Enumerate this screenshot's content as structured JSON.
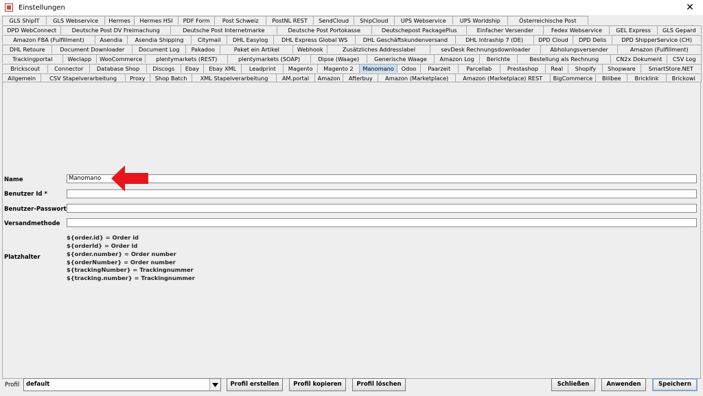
{
  "window": {
    "title": "Einstellungen",
    "icon": "app-icon",
    "close_icon": "close-icon"
  },
  "tabs": {
    "row1": [
      "GLS ShipIT",
      "GLS Webservice",
      "Hermes",
      "Hermes HSI",
      "PDF Form",
      "Post Schweiz",
      "PostNL REST",
      "SendCloud",
      "ShipCloud",
      "UPS Webservice",
      "UPS Worldship",
      "Österreichische Post"
    ],
    "row2": [
      "DPD WebConnect",
      "Deutsche Post DV Freimachung",
      "Deutsche Post Internetmarke",
      "Deutsche Post Portokasse",
      "Deutschepost PackagePlus",
      "Einfacher Versender",
      "Fedex Webservice",
      "GEL Express",
      "GLS Gepard"
    ],
    "row3": [
      "Amazon FBA (Fulfillment)",
      "Asendia",
      "Asendia Shipping",
      "Citymail",
      "DHL Easylog",
      "DHL Express Global WS",
      "DHL Geschäftskundenversand",
      "DHL Intraship 7 (DE)",
      "DPD Cloud",
      "DPD Delis",
      "DPD ShipperService (CH)"
    ],
    "row4": [
      "DHL Retoure",
      "Document Downloader",
      "Document Log",
      "Pakadoo",
      "Paket ein Artikel",
      "Webhook",
      "Zusätzliches Addresslabel",
      "sevDesk Rechnungsdownloader",
      "Abholungsversender",
      "Amazon (Fulfillment)"
    ],
    "row5": [
      "Trackingportal",
      "Weclapp",
      "WooCommerce",
      "plentymarkets (REST)",
      "plentymarkets (SOAP)",
      "Dipse (Waage)",
      "Generische Waage",
      "Amazon Log",
      "Berichte",
      "Bestellung als Rechnung",
      "CN2x Dokument",
      "CSV Log"
    ],
    "row6": [
      "Brickscout",
      "Connector",
      "Database Shop",
      "Discogs",
      "Ebay",
      "Ebay XML",
      "Leadprint",
      "Magento",
      "Magento 2",
      "Manomano",
      "Odoo",
      "Paarzeit",
      "Parcellab",
      "Prestashop",
      "Real",
      "Shopify",
      "Shopware",
      "SmartStore.NET"
    ],
    "row7": [
      "Allgemein",
      "CSV Stapelverarbeitung",
      "Proxy",
      "Shop Batch",
      "XML Stapelverarbeitung",
      "AM.portal",
      "Amazon",
      "Afterbuy",
      "Amazon (Marketplace)",
      "Amazon (Marketplace) REST",
      "BigCommerce",
      "Billbee",
      "Bricklink",
      "Brickowl"
    ],
    "selected": "Manomano"
  },
  "form": {
    "name_label": "Name",
    "name_value": "Manomano",
    "user_id_label": "Benutzer Id *",
    "user_id_value": "",
    "password_label": "Benutzer-Passwort *",
    "password_value": "",
    "shipping_method_label": "Versandmethode",
    "shipping_method_value": "",
    "placeholder_label": "Platzhalter",
    "placeholders": [
      "${order.id} = Order id",
      "${orderId} = Order id",
      "${order.number} = Order number",
      "${orderNumber} = Order number",
      "${trackingNumber} = Trackingnummer",
      "${tracking.number} =  Trackingnummer"
    ]
  },
  "annotation": {
    "arrow_icon": "red-arrow-icon",
    "color": "#e8161b"
  },
  "footer": {
    "profile_label": "Profil",
    "profile_value": "default",
    "create_profile": "Profil erstellen",
    "copy_profile": "Profil kopieren",
    "delete_profile": "Profil löschen",
    "close": "Schließen",
    "apply": "Anwenden",
    "save": "Speichern"
  },
  "colors": {
    "selected_tab": "#c8ddf2",
    "window_bg": "#eeeeee"
  }
}
